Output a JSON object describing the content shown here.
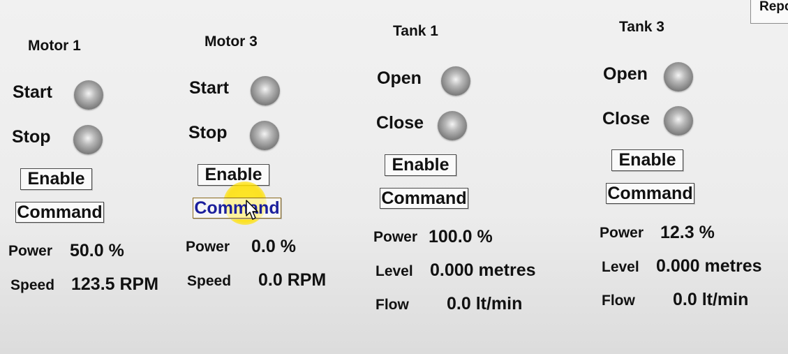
{
  "report_button_label": "Repo",
  "panels": [
    {
      "title": "Motor 1",
      "indicators": [
        "Start",
        "Stop"
      ],
      "enable_label": "Enable",
      "command_label": "Command",
      "readouts": [
        {
          "label": "Power",
          "value": "50.0 %"
        },
        {
          "label": "Speed",
          "value": "123.5 RPM"
        }
      ]
    },
    {
      "title": "Motor 3",
      "indicators": [
        "Start",
        "Stop"
      ],
      "enable_label": "Enable",
      "command_label": "Command",
      "readouts": [
        {
          "label": "Power",
          "value": "0.0 %"
        },
        {
          "label": "Speed",
          "value": "0.0 RPM"
        }
      ]
    },
    {
      "title": "Tank 1",
      "indicators": [
        "Open",
        "Close"
      ],
      "enable_label": "Enable",
      "command_label": "Command",
      "readouts": [
        {
          "label": "Power",
          "value": "100.0 %"
        },
        {
          "label": "Level",
          "value": "0.000 metres"
        },
        {
          "label": "Flow",
          "value": "0.0 lt/min"
        }
      ]
    },
    {
      "title": "Tank 3",
      "indicators": [
        "Open",
        "Close"
      ],
      "enable_label": "Enable",
      "command_label": "Command",
      "readouts": [
        {
          "label": "Power",
          "value": "12.3 %"
        },
        {
          "label": "Level",
          "value": "0.000 metres"
        },
        {
          "label": "Flow",
          "value": "0.0 lt/min"
        }
      ]
    }
  ]
}
